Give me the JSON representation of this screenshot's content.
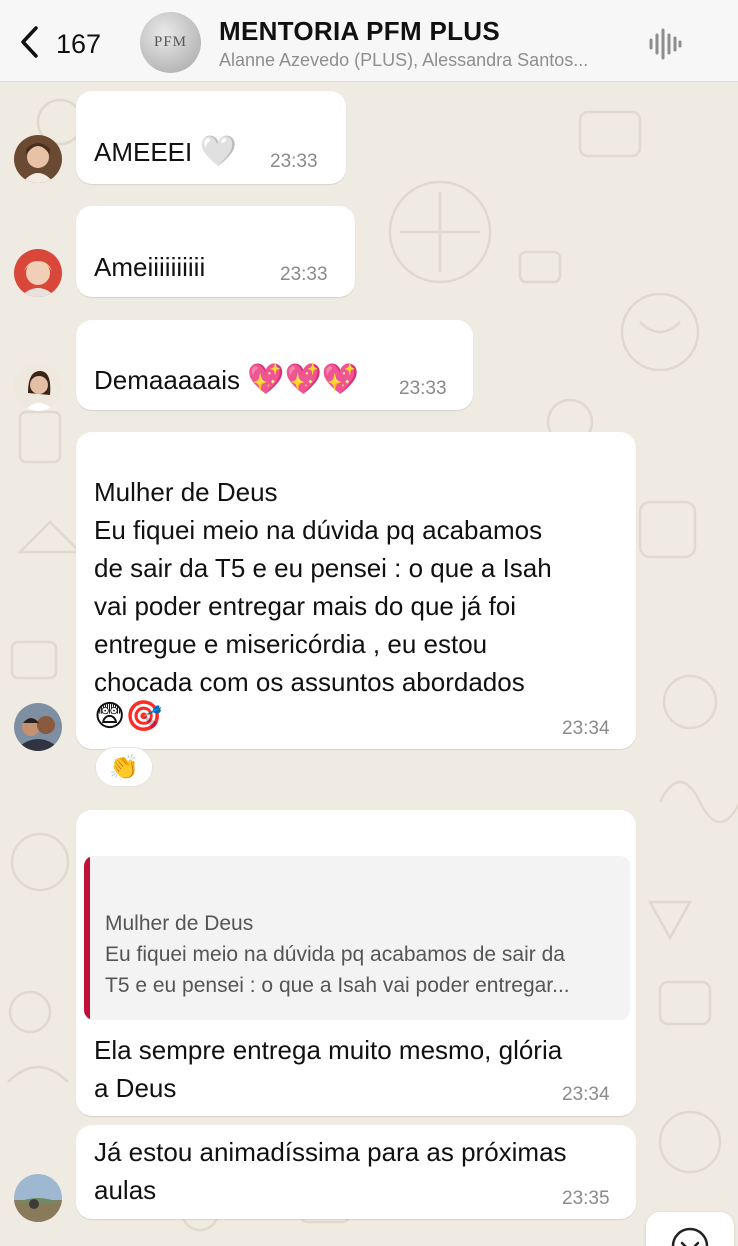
{
  "header": {
    "back_count": "167",
    "title": "MENTORIA PFM PLUS",
    "subtitle": "Alanne Azevedo (PLUS), Alessandra Santos...",
    "avatar_text": "PFM"
  },
  "messages": [
    {
      "text": "AMEEEI",
      "emoji": "🤍",
      "time": "23:33"
    },
    {
      "text": "Ameiiiiiiiiii",
      "time": "23:33"
    },
    {
      "text": "Demaaaaais",
      "emoji": "💖💖💖",
      "time": "23:33"
    },
    {
      "lines": [
        "Mulher de Deus",
        "Eu fiquei meio na dúvida pq acabamos",
        "de sair da T5 e eu pensei : o que a Isah",
        "vai poder entregar mais do que já foi",
        "entregue e misericórdia , eu estou",
        "chocada com os assuntos abordados"
      ],
      "emoji": "😨🎯",
      "time": "23:34",
      "reaction": "👏"
    },
    {
      "quote": {
        "name": "Mulher de Deus",
        "line1": "Eu fiquei meio na dúvida pq acabamos de sair da",
        "line2": "T5 e eu pensei : o que a Isah vai poder entregar..."
      },
      "lines": [
        "Ela sempre entrega muito mesmo, glória",
        "a Deus"
      ],
      "time": "23:34"
    },
    {
      "lines": [
        "Já estou animadíssima para as próximas",
        "aulas"
      ],
      "time": "23:35"
    }
  ],
  "colors": {
    "background": "#efeae2",
    "quote_bar": "#c0113a",
    "bubble": "#ffffff"
  },
  "icons": [
    "chevron-left-icon",
    "audio-wave-icon",
    "chevron-down-icon"
  ]
}
